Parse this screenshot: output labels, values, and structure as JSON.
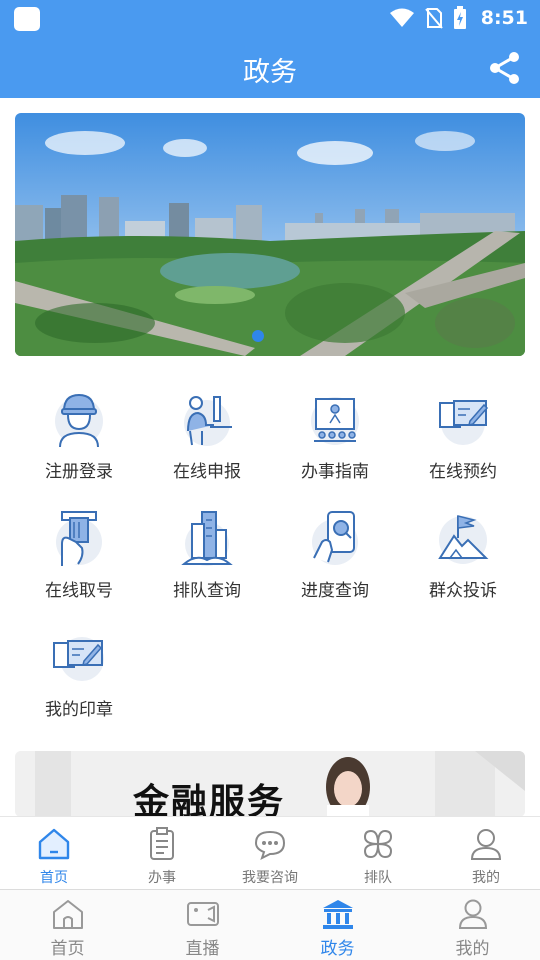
{
  "status_bar": {
    "time": "8:51"
  },
  "header": {
    "title": "政务"
  },
  "banner": {
    "slide_count": 1,
    "active_slide": 1
  },
  "services": [
    {
      "label": "注册登录",
      "icon": "registration-worker-icon"
    },
    {
      "label": "在线申报",
      "icon": "online-declaration-icon"
    },
    {
      "label": "办事指南",
      "icon": "service-guide-icon"
    },
    {
      "label": "在线预约",
      "icon": "online-appointment-icon"
    },
    {
      "label": "在线取号",
      "icon": "take-number-icon"
    },
    {
      "label": "排队查询",
      "icon": "queue-query-icon"
    },
    {
      "label": "进度查询",
      "icon": "progress-query-icon"
    },
    {
      "label": "群众投诉",
      "icon": "complaint-flag-icon"
    },
    {
      "label": "我的印章",
      "icon": "my-seal-icon"
    }
  ],
  "promo": {
    "text": "金融服务"
  },
  "inner_tabs": [
    {
      "label": "首页",
      "icon": "home-icon",
      "active": true
    },
    {
      "label": "办事",
      "icon": "clipboard-icon",
      "active": false
    },
    {
      "label": "我要咨询",
      "icon": "chat-icon",
      "active": false
    },
    {
      "label": "排队",
      "icon": "four-leaf-icon",
      "active": false
    },
    {
      "label": "我的",
      "icon": "user-icon",
      "active": false
    }
  ],
  "main_tabs": [
    {
      "label": "首页",
      "icon": "home-icon",
      "active": false
    },
    {
      "label": "直播",
      "icon": "video-icon",
      "active": false
    },
    {
      "label": "政务",
      "icon": "government-building-icon",
      "active": true
    },
    {
      "label": "我的",
      "icon": "user-icon",
      "active": false
    }
  ],
  "colors": {
    "primary": "#4a9af0",
    "accent": "#2f86ea",
    "icon_blue": "#3a6fb5"
  }
}
